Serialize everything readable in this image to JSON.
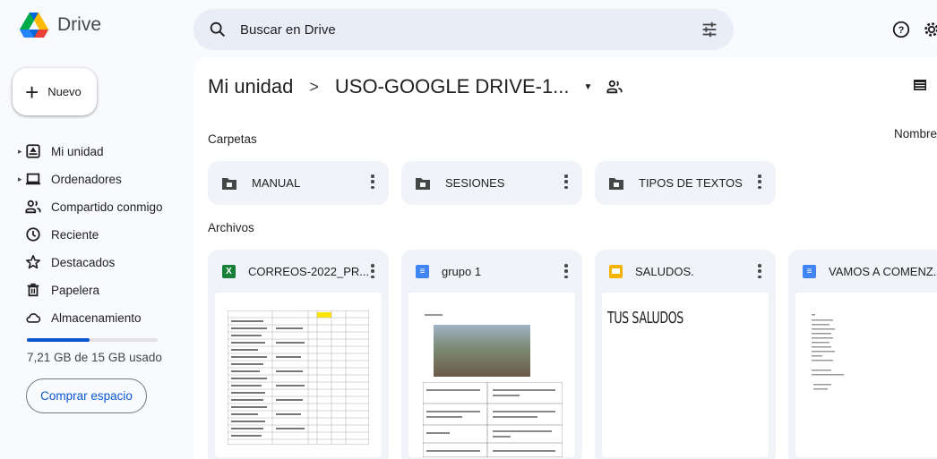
{
  "app": {
    "name": "Drive"
  },
  "search": {
    "placeholder": "Buscar en Drive"
  },
  "sidebar": {
    "new_label": "Nuevo",
    "items": [
      {
        "label": "Mi unidad",
        "icon": "my-drive-icon"
      },
      {
        "label": "Ordenadores",
        "icon": "computers-icon"
      },
      {
        "label": "Compartido conmigo",
        "icon": "shared-icon"
      },
      {
        "label": "Reciente",
        "icon": "recent-icon"
      },
      {
        "label": "Destacados",
        "icon": "star-icon"
      },
      {
        "label": "Papelera",
        "icon": "trash-icon"
      },
      {
        "label": "Almacenamiento",
        "icon": "cloud-icon"
      }
    ],
    "storage_used_fraction": 0.48,
    "storage_text": "7,21 GB de 15 GB usado",
    "buy_label": "Comprar espacio"
  },
  "breadcrumb": {
    "root": "Mi unidad",
    "separator": ">",
    "current": "USO-GOOGLE DRIVE-1..."
  },
  "sections": {
    "folders": "Carpetas",
    "files": "Archivos",
    "sort": "Nombre"
  },
  "folders": [
    {
      "name": "MANUAL"
    },
    {
      "name": "SESIONES"
    },
    {
      "name": "TIPOS DE TEXTOS"
    }
  ],
  "files": [
    {
      "name": "CORREOS-2022_PR...",
      "type": "sheet",
      "type_letter": "X",
      "color": "#188038"
    },
    {
      "name": "grupo 1",
      "type": "doc",
      "type_letter": "≡",
      "color": "#4285f4"
    },
    {
      "name": "SALUDOS.",
      "type": "slide",
      "type_letter": "",
      "color": "#f4b400"
    },
    {
      "name": "VAMOS A COMENZ...",
      "type": "doc",
      "type_letter": "≡",
      "color": "#4285f4"
    }
  ],
  "thumbs": {
    "slide_title": "TUS SALUDOS"
  },
  "colors": {
    "accent": "#0b57d0",
    "surface": "#f0f4f9",
    "search_bg": "#e9eef6"
  }
}
